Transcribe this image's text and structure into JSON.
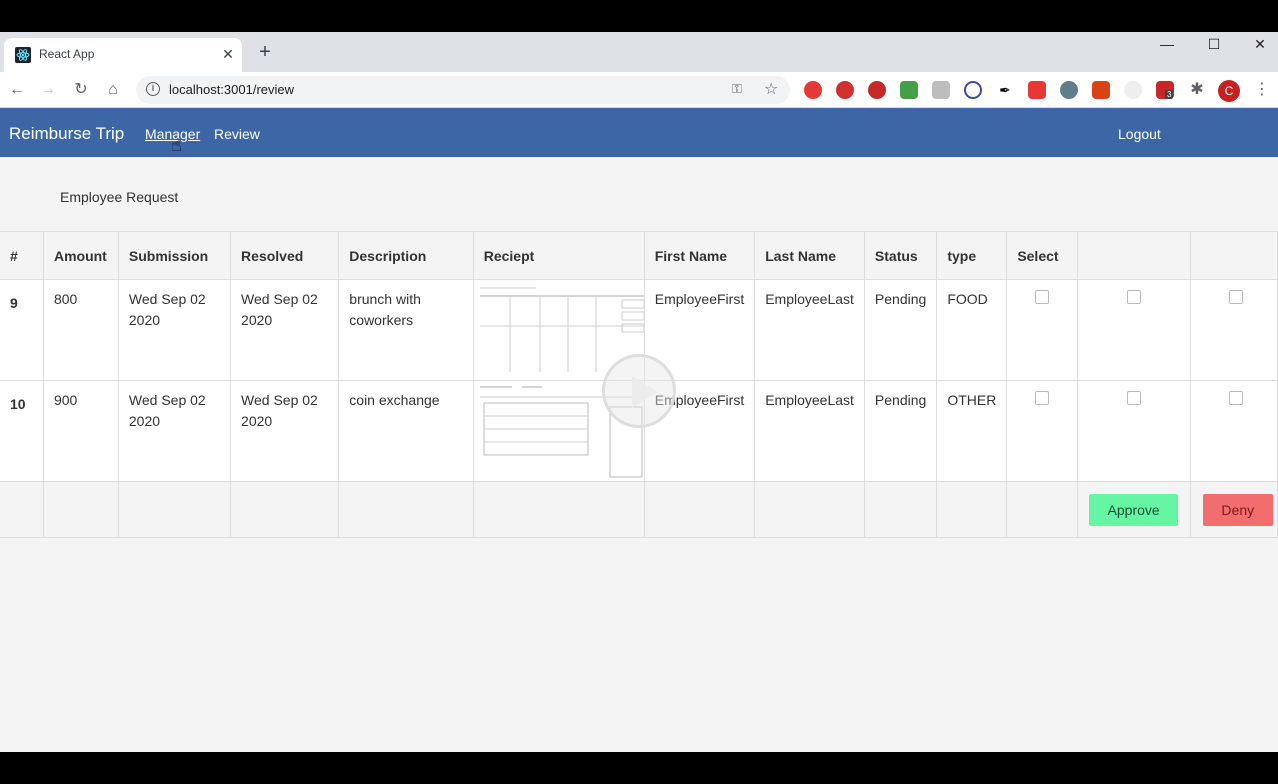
{
  "browser": {
    "tab_title": "React App",
    "url": "localhost:3001/review",
    "extension_badge": "3",
    "profile_initial": "C"
  },
  "app": {
    "brand": "Reimburse Trip",
    "nav": {
      "manager": "Manager",
      "review": "Review",
      "logout": "Logout"
    },
    "subtitle": "Employee Request",
    "table": {
      "headers": [
        "#",
        "Amount",
        "Submission",
        "Resolved",
        "Description",
        "Reciept",
        "First Name",
        "Last Name",
        "Status",
        "type",
        "Select",
        "",
        ""
      ],
      "rows": [
        {
          "id": "9",
          "amount": "800",
          "submission": "Wed Sep 02 2020",
          "resolved": "Wed Sep 02 2020",
          "description": "brunch with coworkers",
          "first_name": "EmployeeFirst",
          "last_name": "EmployeeLast",
          "status": "Pending",
          "type": "FOOD"
        },
        {
          "id": "10",
          "amount": "900",
          "submission": "Wed Sep 02 2020",
          "resolved": "Wed Sep 02 2020",
          "description": "coin exchange",
          "first_name": "EmployeeFirst",
          "last_name": "EmployeeLast",
          "status": "Pending",
          "type": "OTHER"
        }
      ]
    },
    "buttons": {
      "approve": "Approve",
      "deny": "Deny"
    }
  },
  "colors": {
    "navbar": "#3d66a6",
    "approve": "#66f5a2",
    "deny": "#f26d6d"
  }
}
